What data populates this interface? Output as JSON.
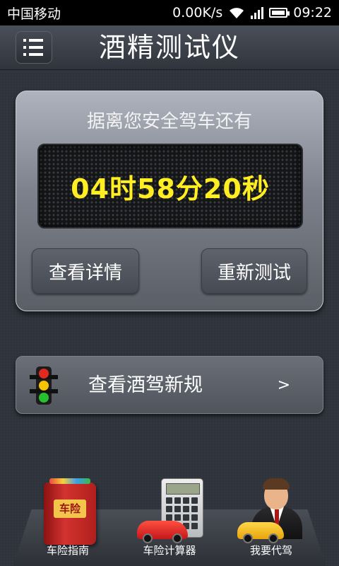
{
  "status_bar": {
    "carrier": "中国移动",
    "net_speed": "0.00K/s",
    "time": "09:22"
  },
  "header": {
    "title": "酒精测试仪"
  },
  "timer_panel": {
    "caption": "据离您安全驾车还有",
    "countdown": "04时58分20秒",
    "details_label": "查看详情",
    "retest_label": "重新测试"
  },
  "rules": {
    "label": "查看酒驾新规",
    "chevron": ">"
  },
  "bottom_nav": {
    "items": [
      {
        "label": "车险指南",
        "icon": "insurance-book-icon",
        "badge": "车险"
      },
      {
        "label": "车险计算器",
        "icon": "calculator-car-icon"
      },
      {
        "label": "我要代驾",
        "icon": "driver-taxi-icon"
      }
    ]
  },
  "colors": {
    "timer_digits": "#ffee22",
    "background": "#2f333c"
  }
}
